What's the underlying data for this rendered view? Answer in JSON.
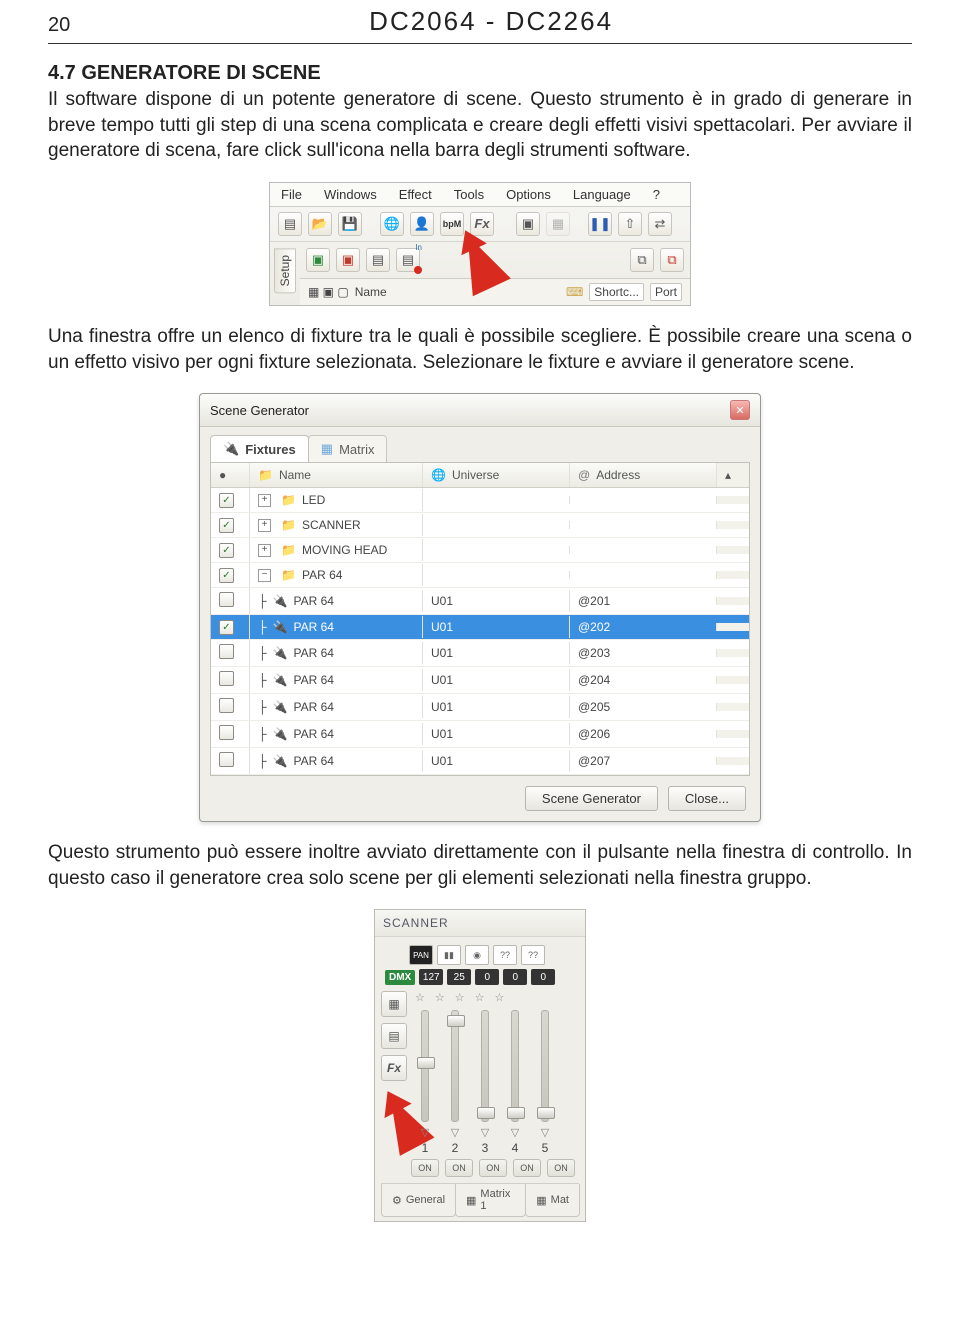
{
  "header": {
    "page": "20",
    "title": "DC2064 - DC2264"
  },
  "section": {
    "num": "4.7",
    "head": "GENERATORE DI SCENE"
  },
  "para1": "Il software dispone di un potente generatore di scene. Questo strumento è in grado di generare in breve tempo tutti gli step di una scena complicata e creare degli effetti visivi spettacolari. Per avviare il generatore di scena, fare click sull'icona nella barra degli strumenti software.",
  "para2": "Una finestra offre un elenco di fixture tra le quali è possibile scegliere. È possibile creare una scena o un effetto visivo per ogni fixture selezionata. Selezionare le fixture e avviare il generatore scene.",
  "para3": "Questo strumento può essere inoltre avviato direttamente con il pulsante nella finestra di controllo. In questo caso il generatore crea solo scene per gli elementi selezionati nella finestra gruppo.",
  "menu": {
    "file": "File",
    "windows": "Windows",
    "effect": "Effect",
    "tools": "Tools",
    "options": "Options",
    "language": "Language",
    "help": "?"
  },
  "toolbar": {
    "bpm": "bpM",
    "fx": "Fx",
    "setup": "Setup",
    "name": "Name",
    "shortc": "Shortc...",
    "port": "Port",
    "in": "In"
  },
  "dialog": {
    "title": "Scene Generator",
    "tabs": {
      "fixtures": "Fixtures",
      "matrix": "Matrix"
    },
    "cols": {
      "name": "Name",
      "universe": "Universe",
      "address": "Address"
    },
    "groups": [
      {
        "label": "LED",
        "exp": "+",
        "ck": true
      },
      {
        "label": "SCANNER",
        "exp": "+",
        "ck": true
      },
      {
        "label": "MOVING HEAD",
        "exp": "+",
        "ck": true
      },
      {
        "label": "PAR 64",
        "exp": "−",
        "ck": true
      }
    ],
    "rows": [
      {
        "ck": false,
        "name": "PAR 64",
        "u": "U01",
        "a": "@201",
        "sel": false
      },
      {
        "ck": true,
        "name": "PAR 64",
        "u": "U01",
        "a": "@202",
        "sel": true
      },
      {
        "ck": false,
        "name": "PAR 64",
        "u": "U01",
        "a": "@203",
        "sel": false
      },
      {
        "ck": false,
        "name": "PAR 64",
        "u": "U01",
        "a": "@204",
        "sel": false
      },
      {
        "ck": false,
        "name": "PAR 64",
        "u": "U01",
        "a": "@205",
        "sel": false
      },
      {
        "ck": false,
        "name": "PAR 64",
        "u": "U01",
        "a": "@206",
        "sel": false
      },
      {
        "ck": false,
        "name": "PAR 64",
        "u": "U01",
        "a": "@207",
        "sel": false
      }
    ],
    "btn_gen": "Scene Generator",
    "btn_close": "Close..."
  },
  "scanner": {
    "title": "SCANNER",
    "pan": "PAN",
    "q": "??",
    "dmx": "DMX",
    "vals": [
      "127",
      "25",
      "0",
      "0",
      "0"
    ],
    "fx": "Fx",
    "nums": [
      "1",
      "2",
      "3",
      "4",
      "5"
    ],
    "on": "ON",
    "tabs": {
      "general": "General",
      "m1": "Matrix 1",
      "m2": "Mat"
    }
  }
}
